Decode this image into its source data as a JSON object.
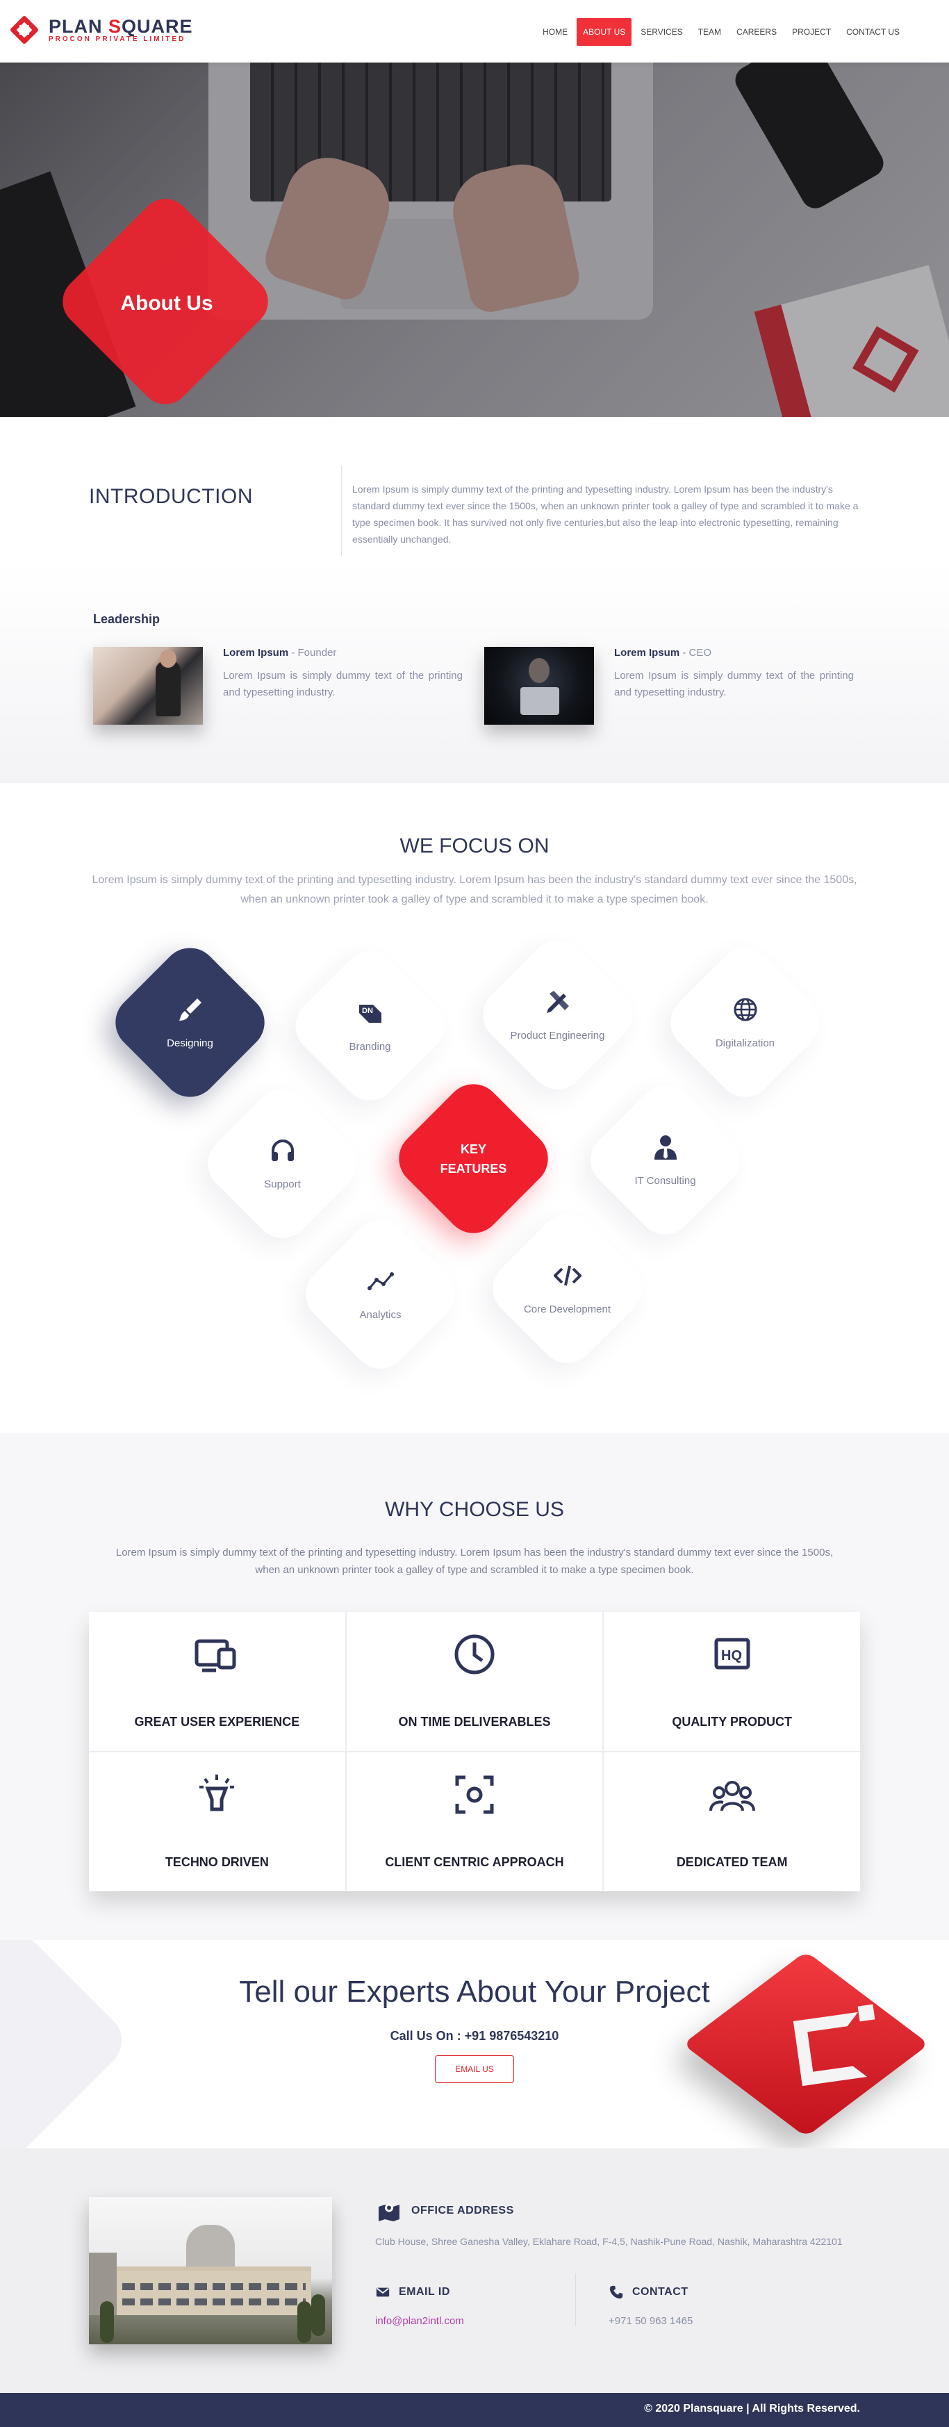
{
  "brand": {
    "name_part1": "PLAN ",
    "name_part2": "S",
    "name_part3": "QUARE",
    "tagline": "PROCON PRIVATE LIMITED"
  },
  "nav": {
    "items": [
      "HOME",
      "ABOUT US",
      "SERVICES",
      "TEAM",
      "CAREERS",
      "PROJECT",
      "CONTACT US"
    ],
    "active": "ABOUT US"
  },
  "hero": {
    "title": "About Us"
  },
  "intro": {
    "title": "INTRODUCTION",
    "text": "Lorem Ipsum is simply dummy text of the printing and typesetting industry. Lorem Ipsum has been the industry's standard dummy text ever since the 1500s, when an unknown printer took a galley of type and scrambled it to make a type specimen book. It has survived not only five centuries,but also the leap into electronic typesetting, remaining essentially unchanged."
  },
  "leadership": {
    "title": "Leadership",
    "people": [
      {
        "name": "Lorem Ipsum",
        "role": " - Founder",
        "desc": "Lorem Ipsum is simply dummy text of the printing and typesetting industry."
      },
      {
        "name": "Lorem Ipsum",
        "role": " - CEO",
        "desc": "Lorem Ipsum is simply dummy text of the printing and typesetting industry."
      }
    ]
  },
  "focus": {
    "title": "WE FOCUS ON",
    "text": "Lorem Ipsum is simply dummy text of the printing and typesetting industry. Lorem Ipsum has been the industry's standard dummy text ever since the 1500s, when an unknown printer took a galley of type and scrambled it to make a type specimen book.",
    "tiles": [
      {
        "label": "Designing",
        "icon": "paintbrush-icon"
      },
      {
        "label": "Branding",
        "icon": "branding-icon"
      },
      {
        "label": "Product Engineering",
        "icon": "pencil-ruler-icon"
      },
      {
        "label": "Digitalization",
        "icon": "globe-icon"
      },
      {
        "label": "Support",
        "icon": "headphones-icon"
      },
      {
        "label": "KEY",
        "label2": "FEATURES"
      },
      {
        "label": "IT Consulting",
        "icon": "user-tie-icon"
      },
      {
        "label": "Analytics",
        "icon": "chart-line-icon"
      },
      {
        "label": "Core Development",
        "icon": "code-icon"
      }
    ]
  },
  "why": {
    "title": "WHY CHOOSE US",
    "text": "Lorem Ipsum is simply dummy text of the printing and typesetting industry. Lorem Ipsum has been the industry's standard dummy text ever since the 1500s, when an unknown printer took a galley of type and scrambled it to make a type specimen book.",
    "items": [
      {
        "label": "GREAT USER EXPERIENCE",
        "icon": "devices-icon"
      },
      {
        "label": "ON TIME DELIVERABLES",
        "icon": "clock-icon"
      },
      {
        "label": "QUALITY PRODUCT",
        "icon": "hq-icon"
      },
      {
        "label": "TECHNO DRIVEN",
        "icon": "bulb-icon"
      },
      {
        "label": "CLIENT CENTRIC APPROACH",
        "icon": "focus-icon"
      },
      {
        "label": "DEDICATED TEAM",
        "icon": "team-icon"
      }
    ]
  },
  "cta": {
    "title": "Tell our Experts About Your Project",
    "call": "Call Us On : +91 9876543210",
    "button": "EMAIL US"
  },
  "contact": {
    "office_title": "OFFICE ADDRESS",
    "address": "Club House, Shree Ganesha Valley, Eklahare Road, F-4,5, Nashik-Pune Road, Nashik, Maharashtra 422101",
    "email_title": "EMAIL ID",
    "email": "info@plan2intl.com",
    "phone_title": "CONTACT",
    "phone": "+971 50 963 1465"
  },
  "footer": {
    "copyright": "© 2020 Plansquare | All Rights Reserved."
  },
  "colors": {
    "navy": "#2e3558",
    "red": "#f01f2e"
  }
}
